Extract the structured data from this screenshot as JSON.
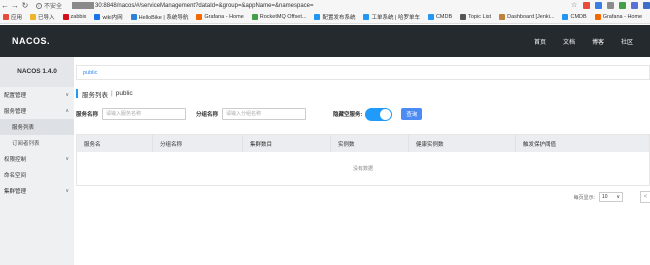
{
  "browser": {
    "security_label": "不安全",
    "url": "30:8848/nacos/#/serviceManagement?dataId=&group=&appName=&namespace=",
    "bookmarks": [
      {
        "label": "应用",
        "color": "#e74c3c"
      },
      {
        "label": "已导入",
        "color": "#f0b429"
      },
      {
        "label": "zabbix",
        "color": "#d4111b"
      },
      {
        "label": "wiki内网",
        "color": "#1a73e8"
      },
      {
        "label": "HelloBike | 系统导航",
        "color": "#2a83d8"
      },
      {
        "label": "Grafana - Home",
        "color": "#f46800"
      },
      {
        "label": "RocketMQ Offset...",
        "color": "#43a047"
      },
      {
        "label": "配置发布系统",
        "color": "#2196f3"
      },
      {
        "label": "工单系统 | 哈罗单车",
        "color": "#2196f3"
      },
      {
        "label": "CMDB",
        "color": "#2196f3"
      },
      {
        "label": "Topic List",
        "color": "#555555"
      },
      {
        "label": "Dashboard [Jenki...",
        "color": "#c0823b"
      },
      {
        "label": "CMDB",
        "color": "#2196f3"
      },
      {
        "label": "Grafana - Home",
        "color": "#f46800"
      }
    ]
  },
  "header": {
    "logo": "NACOS.",
    "nav": [
      "首页",
      "文档",
      "博客",
      "社区"
    ]
  },
  "sidebar": {
    "version": "NACOS 1.4.0",
    "items": [
      {
        "label": "配置管理",
        "chevron": "∨",
        "sub": false,
        "active": false
      },
      {
        "label": "服务管理",
        "chevron": "∧",
        "sub": false,
        "active": false
      },
      {
        "label": "服务列表",
        "chevron": "",
        "sub": true,
        "active": true
      },
      {
        "label": "订阅者列表",
        "chevron": "",
        "sub": true,
        "active": false
      },
      {
        "label": "权限控制",
        "chevron": "∨",
        "sub": false,
        "active": false
      },
      {
        "label": "命名空间",
        "chevron": "",
        "sub": false,
        "active": false
      },
      {
        "label": "集群管理",
        "chevron": "∨",
        "sub": false,
        "active": false
      }
    ]
  },
  "main": {
    "namespace_tab": "public",
    "title": "服务列表",
    "title_sep": "|",
    "title_namespace": "public",
    "filters": {
      "service_label": "服务名称",
      "service_placeholder": "请输入服务名称",
      "group_label": "分组名称",
      "group_placeholder": "请输入分组名称",
      "hide_empty_label": "隐藏空服务:",
      "hide_empty_on": true,
      "query_button": "查询"
    },
    "table": {
      "columns": [
        "服务名",
        "分组名称",
        "集群数目",
        "实例数",
        "健康实例数",
        "触发保护阈值"
      ],
      "empty_text": "没有数据"
    },
    "pagination": {
      "page_size_label": "每页显示:",
      "page_size": "10",
      "prev": "<"
    }
  }
}
